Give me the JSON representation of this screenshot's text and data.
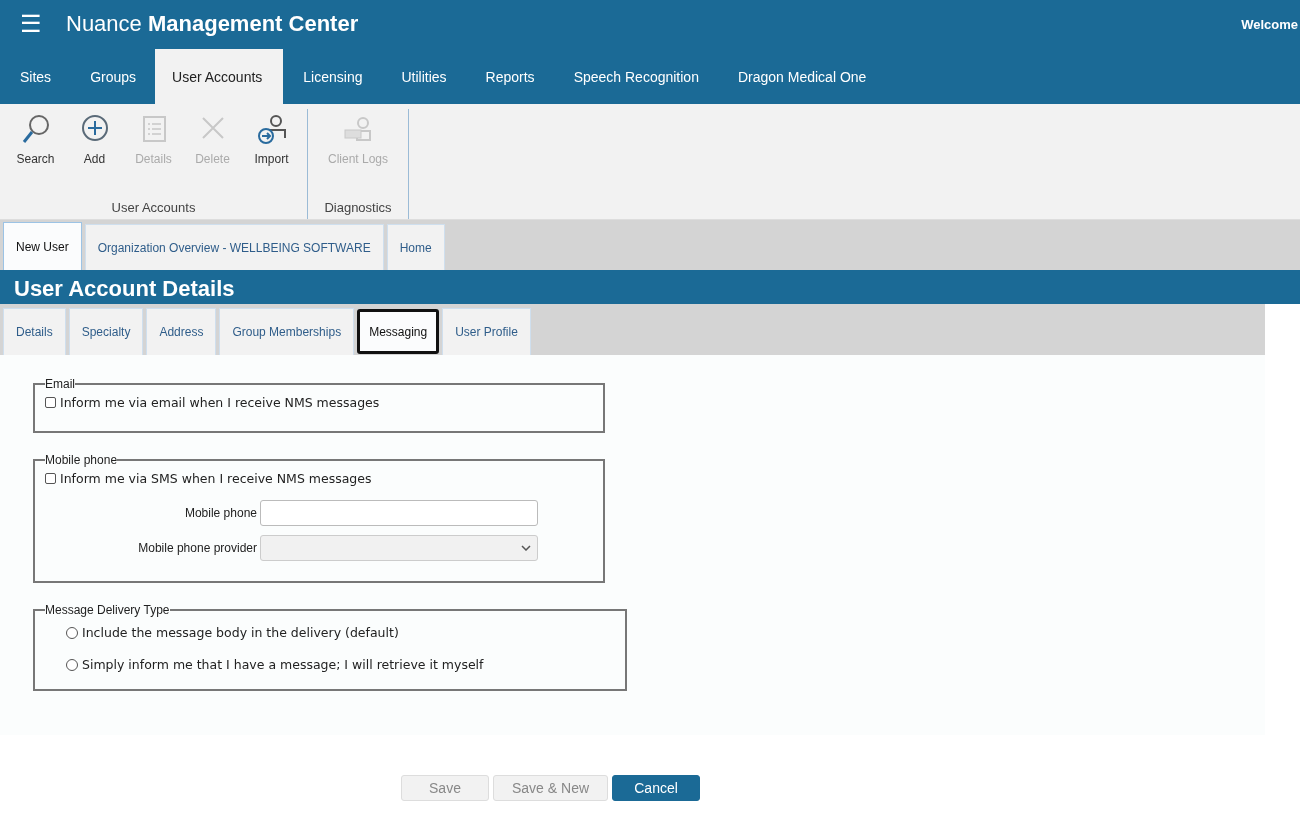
{
  "header": {
    "menu_glyph": "☰",
    "title": "Nuance **Management Center**",
    "welcome": "Welcome"
  },
  "nav_tabs": [
    {
      "label": "Sites",
      "selected": false
    },
    {
      "label": "Groups",
      "selected": false
    },
    {
      "label": "User Accounts",
      "selected": true
    },
    {
      "label": "Licensing",
      "selected": false
    },
    {
      "label": "Utilities",
      "selected": false
    },
    {
      "label": "Reports",
      "selected": false
    },
    {
      "label": "Speech Recognition",
      "selected": false
    },
    {
      "label": "Dragon Medical One",
      "selected": false
    }
  ],
  "ribbon_groups": [
    {
      "label": "User Accounts",
      "buttons": [
        {
          "kind": "search",
          "label": "Search",
          "disabled": false
        },
        {
          "kind": "add",
          "label": "Add",
          "disabled": false
        },
        {
          "kind": "details",
          "label": "Details",
          "disabled": true
        },
        {
          "kind": "delete",
          "label": "Delete",
          "disabled": true
        },
        {
          "kind": "import",
          "label": "Import",
          "disabled": false
        }
      ]
    },
    {
      "label": "Diagnostics",
      "buttons": [
        {
          "kind": "logs",
          "label": "Client Logs",
          "disabled": true
        }
      ]
    }
  ],
  "doc_tabs": [
    {
      "label": "New User",
      "selected": true
    },
    {
      "label": "Organization Overview - WELLBEING SOFTWARE",
      "selected": false
    },
    {
      "label": "Home",
      "selected": false
    }
  ],
  "page_title": "User Account Details",
  "sub_tabs": [
    {
      "label": "Details",
      "selected": false
    },
    {
      "label": "Specialty",
      "selected": false
    },
    {
      "label": "Address",
      "selected": false
    },
    {
      "label": "Group Memberships",
      "selected": false
    },
    {
      "label": "Messaging",
      "selected": true
    },
    {
      "label": "User Profile",
      "selected": false
    }
  ],
  "email": {
    "legend": "Email",
    "checkbox": {
      "label": "Inform me via email when I receive NMS messages",
      "checked": false
    }
  },
  "mobile": {
    "legend": "Mobile phone",
    "checkbox": {
      "label": "Inform me via SMS when I receive NMS messages",
      "checked": false
    },
    "phone_label": "Mobile phone",
    "provider_label": "Mobile phone provider"
  },
  "delivery": {
    "legend": "Message Delivery Type",
    "options": [
      {
        "label": "Include the message body in the delivery (default)",
        "selected": false
      },
      {
        "label": "Simply inform me that I have a message; I will retrieve it myself",
        "selected": false
      }
    ]
  },
  "buttons": [
    {
      "kind": "secondary",
      "label": "Save",
      "disabled": true
    },
    {
      "kind": "secondary",
      "label": "Save & New",
      "disabled": true
    },
    {
      "kind": "primary",
      "label": "Cancel",
      "disabled": false
    }
  ]
}
